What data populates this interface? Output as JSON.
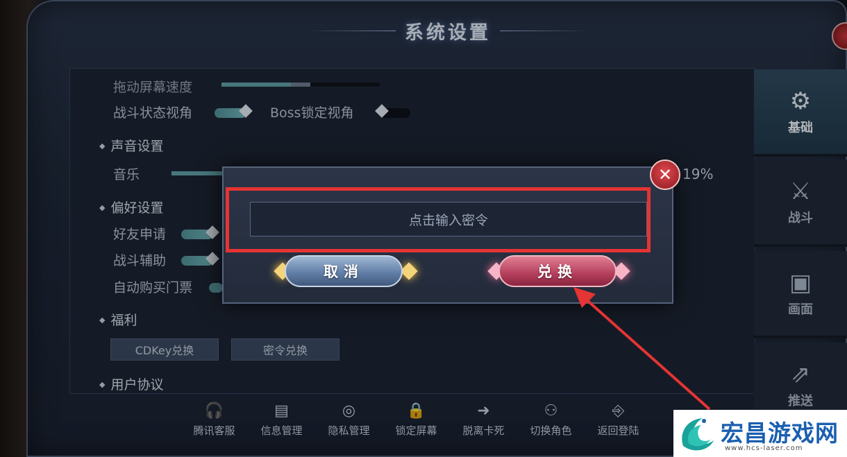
{
  "window": {
    "title": "系统设置"
  },
  "settings": {
    "drag_speed_label": "拖动屏幕速度",
    "battle_view_label": "战斗状态视角",
    "boss_lock_label": "Boss锁定视角",
    "sound_section": "声音设置",
    "music_label": "音乐",
    "music_percent": "19%",
    "music_value": 0.19,
    "preference_section": "偏好设置",
    "friend_request_label": "好友申请",
    "battle_assist_label": "战斗辅助",
    "auto_buy_label": "自动购买门票",
    "welfare_section": "福利",
    "cdkey_button": "CDKey兑换",
    "password_button": "密令兑换",
    "agreement_section": "用户协议"
  },
  "bottom_bar": [
    {
      "label": "腾讯客服",
      "icon": "headset-icon"
    },
    {
      "label": "信息管理",
      "icon": "document-icon"
    },
    {
      "label": "隐私管理",
      "icon": "privacy-lock-icon"
    },
    {
      "label": "锁定屏幕",
      "icon": "lock-icon"
    },
    {
      "label": "脱离卡死",
      "icon": "exit-icon"
    },
    {
      "label": "切换角色",
      "icon": "user-switch-icon"
    },
    {
      "label": "返回登陆",
      "icon": "return-door-icon"
    }
  ],
  "tabs": [
    {
      "label": "基础",
      "icon": "gear-icon",
      "active": true
    },
    {
      "label": "战斗",
      "icon": "shield-sword-icon",
      "active": false
    },
    {
      "label": "画面",
      "icon": "image-icon",
      "active": false
    },
    {
      "label": "推送",
      "icon": "share-icon",
      "active": false
    }
  ],
  "dialog": {
    "input_placeholder": "点击输入密令",
    "cancel_label": "取消",
    "exchange_label": "兑换"
  },
  "watermark": {
    "name": "宏昌游戏网",
    "url": "www.hcs-laser.com"
  },
  "colors": {
    "highlight_frame": "#e53434",
    "exchange_button": "#b43e5c",
    "cancel_button": "#5d7aa3",
    "accent": "#5f9fa6"
  }
}
